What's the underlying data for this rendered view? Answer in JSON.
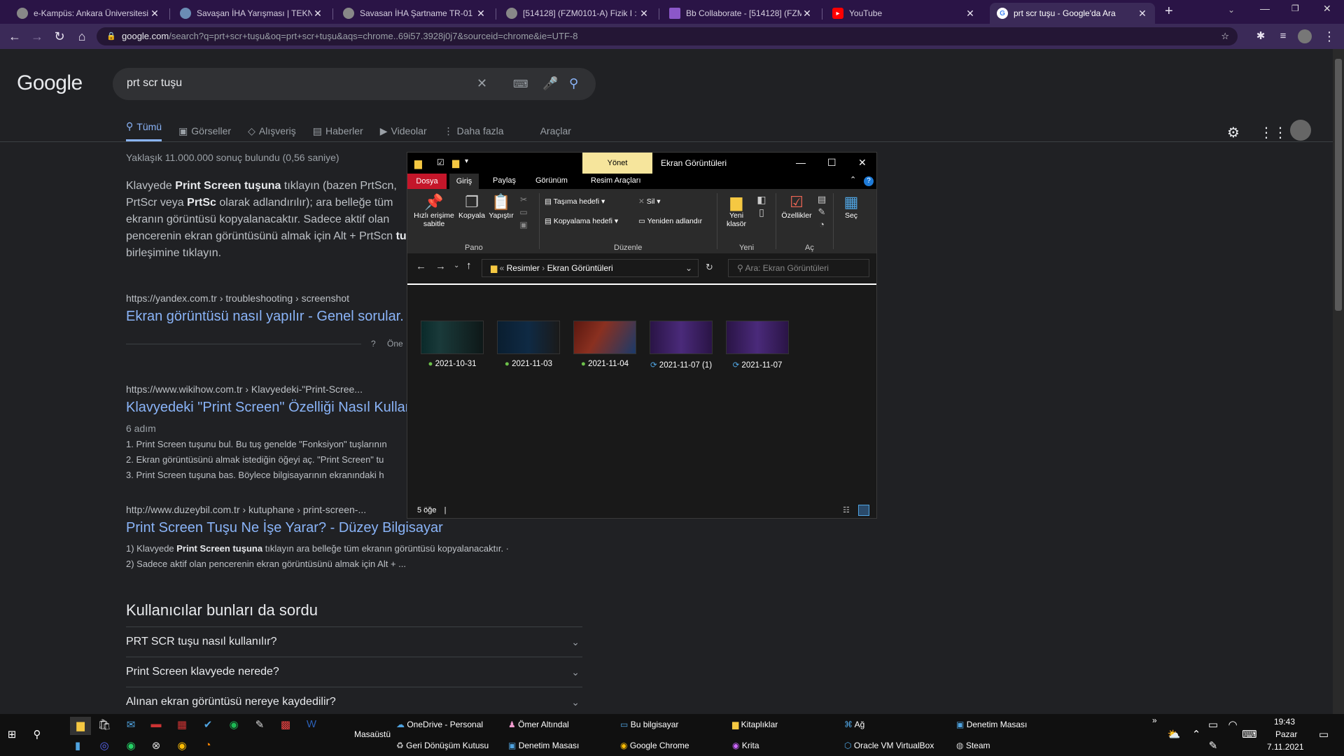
{
  "browser": {
    "tabs": [
      {
        "title": "e-Kampüs: Ankara Üniversitesi ...",
        "favicon": "globe-icon"
      },
      {
        "title": "Savaşan İHA Yarışması | TEKNOF...",
        "favicon": "teknofest-icon"
      },
      {
        "title": "Savasan İHA Şartname TR-01",
        "favicon": "globe-icon"
      },
      {
        "title": "[514128] (FZM0101-A) Fizik I : S...",
        "favicon": "globe-icon"
      },
      {
        "title": "Bb Collaborate - [514128] (FZM...",
        "favicon": "blackboard-icon"
      },
      {
        "title": "YouTube",
        "favicon": "youtube-icon"
      },
      {
        "title": "prt scr tuşu - Google'da Ara",
        "favicon": "google-icon"
      }
    ],
    "new_tab": "+",
    "url_host": "google.com",
    "url_rest": "/search?q=prt+scr+tuşu&oq=prt+scr+tuşu&aqs=chrome..69i57.3928j0j7&sourceid=chrome&ie=UTF-8"
  },
  "google": {
    "logo": "Google",
    "query": "prt scr tuşu",
    "tabs": [
      "Tümü",
      "Görseller",
      "Alışveriş",
      "Haberler",
      "Videolar",
      "Daha fazla",
      "Araçlar"
    ],
    "stats": "Yaklaşık 11.000.000 sonuç bulundu (0,56 saniye)",
    "snippet": {
      "l1a": "Klavyede ",
      "l1b": "Print Screen tuşuna",
      "l1c": " tıklayın (bazen PrtScn,",
      "l2a": "PrtScr veya ",
      "l2b": "PrtSc",
      "l2c": " olarak adlandırılır); ara belleğe tüm",
      "l3": "ekranın görüntüsü kopyalanacaktır. Sadece aktif olan",
      "l4a": "pencerenin ekran görüntüsünü almak için Alt + PrtScn ",
      "l4b": "tu",
      "l5": "birleşimine tıklayın."
    },
    "results": [
      {
        "cite": "https://yandex.com.tr › troubleshooting › screenshot",
        "title": "Ekran görüntüsü nasıl yapılır - Genel sorular.",
        "extra": "Öne"
      },
      {
        "cite": "https://www.wikihow.com.tr › Klavyedeki-\"Print-Scree...",
        "title": "Klavyedeki \"Print Screen\" Özelliği Nasıl Kullar",
        "meta": "6 adım",
        "items": [
          "1.  Print Screen tuşunu bul. Bu tuş genelde \"Fonksiyon\" tuşlarının",
          "2.  Ekran görüntüsünü almak istediğin öğeyi aç. \"Print Screen\" tu",
          "3.  Print Screen tuşuna bas. Böylece bilgisayarının ekranındaki h"
        ]
      },
      {
        "cite": "http://www.duzeybil.com.tr › kutuphane › print-screen-...",
        "title": "Print Screen Tuşu Ne İşe Yarar? - Düzey Bilgisayar",
        "s1a": "1) Klavyede ",
        "s1b": "Print Screen tuşuna",
        "s1c": " tıklayın ara belleğe tüm ekranın görüntüsü kopyalanacaktır. ·",
        "s2": "2) Sadece aktif olan pencerenin ekran görüntüsünü almak için Alt + ..."
      }
    ],
    "paa_title": "Kullanıcılar bunları da sordu",
    "paa": [
      "PRT SCR tuşu nasıl kullanılır?",
      "Print Screen klavyede nerede?",
      "Alınan ekran görüntüsü nereye kaydedilir?"
    ]
  },
  "explorer": {
    "yonet": "Yönet",
    "title": "Ekran Görüntüleri",
    "ribbon_tabs": [
      "Dosya",
      "Giriş",
      "Paylaş",
      "Görünüm",
      "Resim Araçları"
    ],
    "buttons": {
      "pin": "Hızlı erişime sabitle",
      "copy": "Kopyala",
      "paste": "Yapıştır",
      "move_to": "Taşıma hedefi",
      "copy_to": "Kopyalama hedefi",
      "delete": "Sil",
      "rename": "Yeniden adlandır",
      "new_folder": "Yeni klasör",
      "properties": "Özellikler",
      "select": "Seç"
    },
    "groups": [
      "Pano",
      "Düzenle",
      "Yeni",
      "Aç"
    ],
    "path": [
      "Resimler",
      "Ekran Görüntüleri"
    ],
    "search_placeholder": "Ara: Ekran Görüntüleri",
    "files": [
      {
        "name": "2021-10-31",
        "status": "synced"
      },
      {
        "name": "2021-11-03",
        "status": "synced"
      },
      {
        "name": "2021-11-04",
        "status": "synced"
      },
      {
        "name": "2021-11-07 (1)",
        "status": "syncing"
      },
      {
        "name": "2021-11-07",
        "status": "syncing"
      }
    ],
    "status_count": "5 öğe"
  },
  "taskbar": {
    "desktop_label": "Masaüstü",
    "shortcuts": [
      "OneDrive - Personal",
      "Ömer Altındal",
      "Bu bilgisayar",
      "Kitaplıklar",
      "Ağ",
      "Denetim Masası",
      "Geri Dönüşüm Kutusu",
      "Denetim Masası",
      "Google Chrome",
      "Krita",
      "Oracle VM VirtualBox",
      "Steam"
    ],
    "time": "19:43",
    "day": "Pazar",
    "date": "7.11.2021"
  }
}
